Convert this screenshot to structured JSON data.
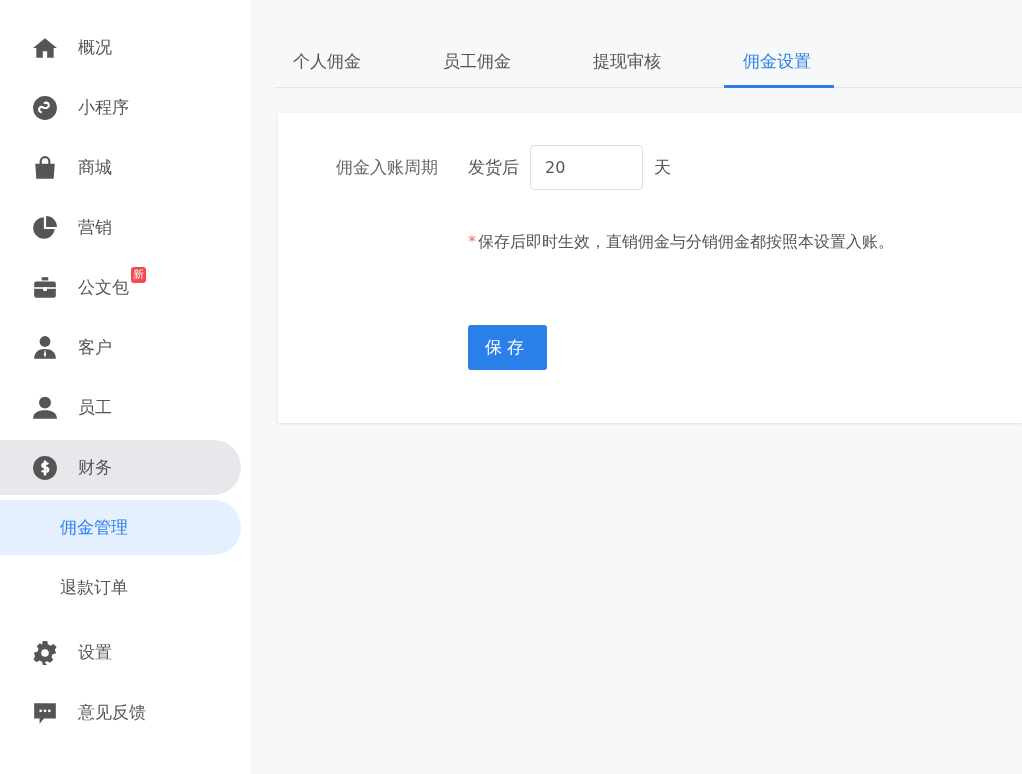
{
  "sidebar": {
    "items": [
      {
        "label": "概况",
        "selected": false
      },
      {
        "label": "小程序",
        "selected": false
      },
      {
        "label": "商城",
        "selected": false
      },
      {
        "label": "营销",
        "selected": false
      },
      {
        "label": "公文包",
        "selected": false,
        "badge": "新"
      },
      {
        "label": "客户",
        "selected": false
      },
      {
        "label": "员工",
        "selected": false
      },
      {
        "label": "财务",
        "selected": false,
        "expanded": true,
        "children": [
          {
            "label": "佣金管理",
            "selected": true
          },
          {
            "label": "退款订单",
            "selected": false
          }
        ]
      },
      {
        "label": "设置",
        "selected": false
      },
      {
        "label": "意见反馈",
        "selected": false
      }
    ]
  },
  "tabs": [
    {
      "label": "个人佣金",
      "selected": false
    },
    {
      "label": "员工佣金",
      "selected": false
    },
    {
      "label": "提现审核",
      "selected": false
    },
    {
      "label": "佣金设置",
      "selected": true
    }
  ],
  "form": {
    "label": "佣金入账周期",
    "prefix": "发货后",
    "value": "20",
    "suffix": "天",
    "note_mark": "*",
    "note": "保存后即时生效，直销佣金与分销佣金都按照本设置入账。",
    "button": "保存"
  }
}
